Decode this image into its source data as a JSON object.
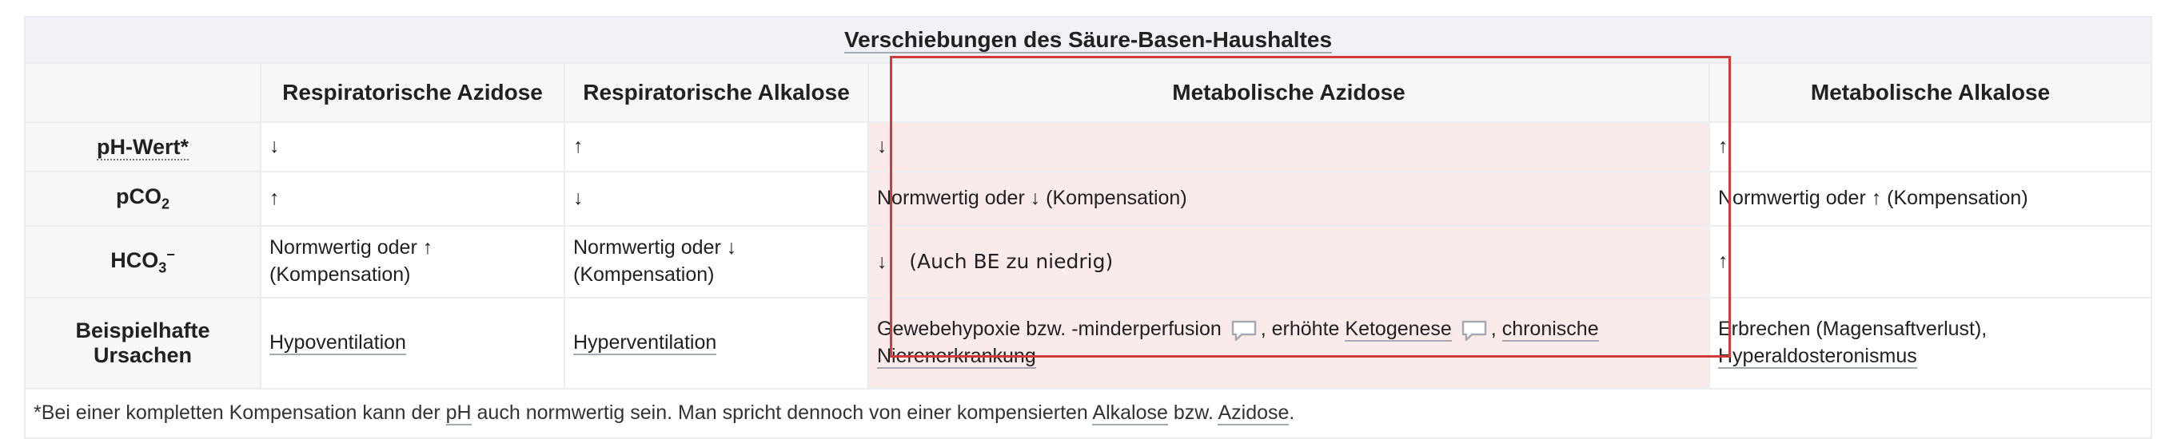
{
  "table": {
    "caption": "Verschiebungen des Säure-Basen-Haushaltes",
    "columns": [
      "Respiratorische Azidose",
      "Respiratorische Alkalose",
      "Metabolische Azidose",
      "Metabolische Alkalose"
    ],
    "rows": {
      "ph": {
        "label": "pH-Wert*",
        "cells": [
          "↓",
          "↑",
          "↓",
          "↑"
        ]
      },
      "pco2": {
        "label_main": "pCO",
        "label_sub": "2",
        "cells": [
          "↑",
          "↓",
          "Normwertig oder ↓ (Kompensation)",
          "Normwertig oder ↑ (Kompensation)"
        ]
      },
      "hco3": {
        "label_main": "HCO",
        "label_sub": "3",
        "label_sup": "−",
        "cells": [
          "Normwertig oder ↑ (Kompensation)",
          "Normwertig oder ↓ (Kompensation)",
          "↓",
          "↑"
        ],
        "note": "(Auch BE zu niedrig)"
      },
      "causes": {
        "label": "Beispielhafte Ursachen",
        "resp_azidose": "Hypoventilation",
        "resp_alkalose": "Hyperventilation",
        "met_azidose": {
          "part1": "Gewebehypoxie bzw. -minderperfusion",
          "part2": ", erhöhte",
          "link_ketogenese": "Ketogenese",
          "part3": ",",
          "link_nieren": "chronische Nierenerkrankung"
        },
        "met_alkalose": {
          "text": "Erbrechen (Magensaftverlust),",
          "link": "Hyperaldosteronismus"
        }
      }
    },
    "footnote": {
      "part1": "*Bei einer kompletten Kompensation kann der",
      "link_ph": "pH",
      "part2": "auch normwertig sein. Man spricht dennoch von einer kompensierten",
      "link_alkalose": "Alkalose",
      "part3": "bzw.",
      "link_azidose": "Azidose",
      "part4": "."
    },
    "highlight_color": "#d23a3a"
  }
}
